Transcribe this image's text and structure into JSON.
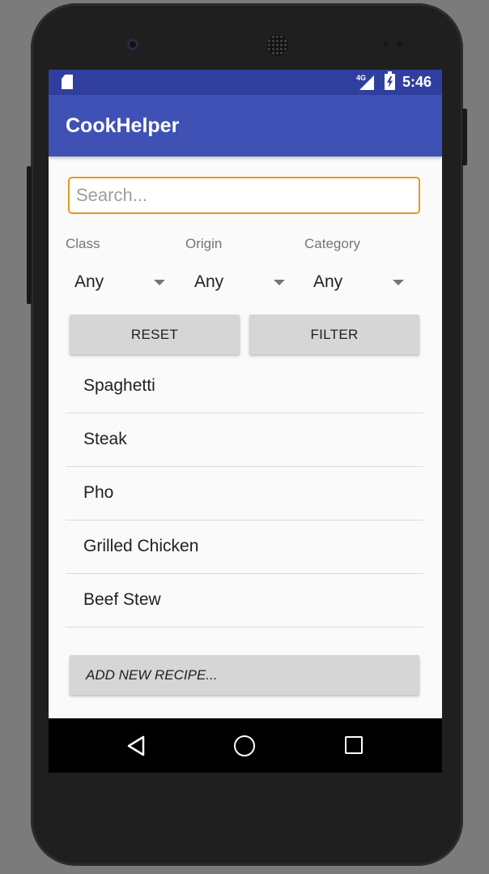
{
  "status_bar": {
    "network_label": "4G",
    "time": "5:46"
  },
  "app_bar": {
    "title": "CookHelper"
  },
  "search": {
    "placeholder": "Search...",
    "value": ""
  },
  "filters": [
    {
      "label": "Class",
      "selected": "Any"
    },
    {
      "label": "Origin",
      "selected": "Any"
    },
    {
      "label": "Category",
      "selected": "Any"
    }
  ],
  "buttons": {
    "reset_label": "RESET",
    "filter_label": "FILTER",
    "add_label": "ADD NEW RECIPE..."
  },
  "recipes": [
    "Spaghetti",
    "Steak",
    "Pho",
    "Grilled Chicken",
    "Beef Stew"
  ],
  "colors": {
    "status_bar": "#303f9f",
    "app_bar": "#3f51b5",
    "search_focus_border": "#e39a1c",
    "button_bg": "#d6d6d6"
  },
  "icons": {
    "status": [
      "sd-card-icon",
      "signal-icon",
      "battery-charging-icon"
    ],
    "nav": [
      "back-icon",
      "home-icon",
      "recents-icon"
    ]
  }
}
